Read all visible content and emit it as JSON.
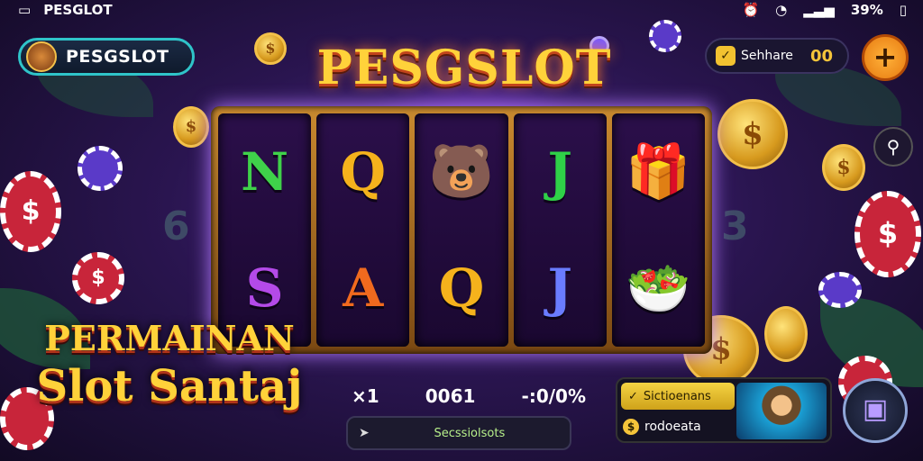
{
  "status_bar": {
    "app_name": "PESGLOT",
    "battery": "39%"
  },
  "brand": {
    "name": "PESGSLOT"
  },
  "logo": {
    "text": "PESGSLOT"
  },
  "balance": {
    "label": "Sehhare",
    "value": "00"
  },
  "plus_button": {
    "symbol": "+"
  },
  "reels": [
    [
      {
        "text": "N",
        "color": "#3fd14a"
      },
      {
        "text": "S",
        "color": "#b44ae8"
      }
    ],
    [
      {
        "text": "Q",
        "color": "#f5b21c"
      },
      {
        "text": "A",
        "color": "#f06a1e"
      }
    ],
    [
      {
        "text": "🐻",
        "color": "#c07a2a"
      },
      {
        "text": "Q",
        "color": "#f5b21c"
      }
    ],
    [
      {
        "text": "J",
        "color": "#2fd048"
      },
      {
        "text": "J",
        "color": "#6a7cff"
      }
    ],
    [
      {
        "text": "🎁",
        "color": "#e84a5a"
      },
      {
        "text": "🥗",
        "color": "#d6a14a"
      }
    ]
  ],
  "side_numbers": {
    "left": "6",
    "right": "3"
  },
  "promo": {
    "line1": "PERMAINAN",
    "line2": "Slot Santaj"
  },
  "stats": {
    "multiplier": "×1",
    "credits": "0061",
    "percent": "-:0/0%"
  },
  "search": {
    "text": "Secssiolsots"
  },
  "panel": {
    "title": "Sictioenans",
    "subtitle": "rodoeata"
  },
  "colors": {
    "accent": "#ffd23a",
    "frame": "#c98a2f",
    "pill_border": "#2fc4c9"
  }
}
